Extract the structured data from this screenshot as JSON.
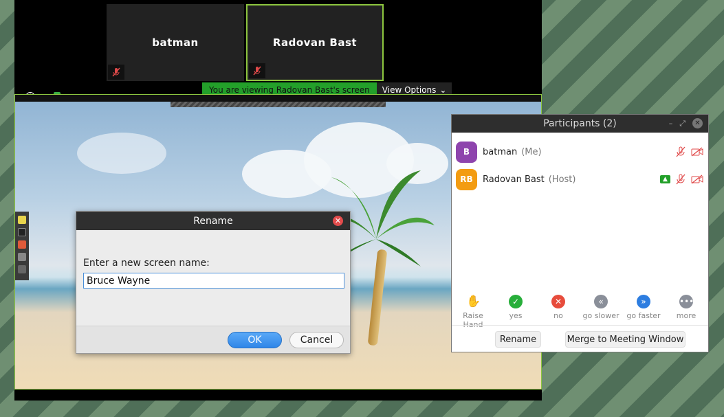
{
  "tiles": [
    {
      "name": "batman"
    },
    {
      "name": "Radovan Bast"
    }
  ],
  "viewing_bar": {
    "label": "You are viewing Radovan Bast's screen",
    "view_options": "View Options"
  },
  "rename_dialog": {
    "title": "Rename",
    "prompt": "Enter a new screen name:",
    "value": "Bruce Wayne",
    "ok": "OK",
    "cancel": "Cancel"
  },
  "participants": {
    "title": "Participants (2)",
    "people": [
      {
        "initials": "B",
        "name": "batman",
        "role": "(Me)",
        "color": "#8e44ad"
      },
      {
        "initials": "RB",
        "name": "Radovan Bast",
        "role": "(Host)",
        "color": "#f39c12"
      }
    ],
    "reactions": [
      {
        "label": "Raise Hand",
        "icon": "hand-icon",
        "color": "#2d7de0"
      },
      {
        "label": "yes",
        "icon": "check-icon",
        "color": "#27ae3a"
      },
      {
        "label": "no",
        "icon": "x-icon",
        "color": "#e74c3c"
      },
      {
        "label": "go slower",
        "icon": "rewind-icon",
        "color": "#8a8f99"
      },
      {
        "label": "go faster",
        "icon": "fast-forward-icon",
        "color": "#2d7de0"
      },
      {
        "label": "more",
        "icon": "more-icon",
        "color": "#8a8f99"
      }
    ],
    "rename_button": "Rename",
    "merge_button": "Merge to Meeting Window"
  }
}
